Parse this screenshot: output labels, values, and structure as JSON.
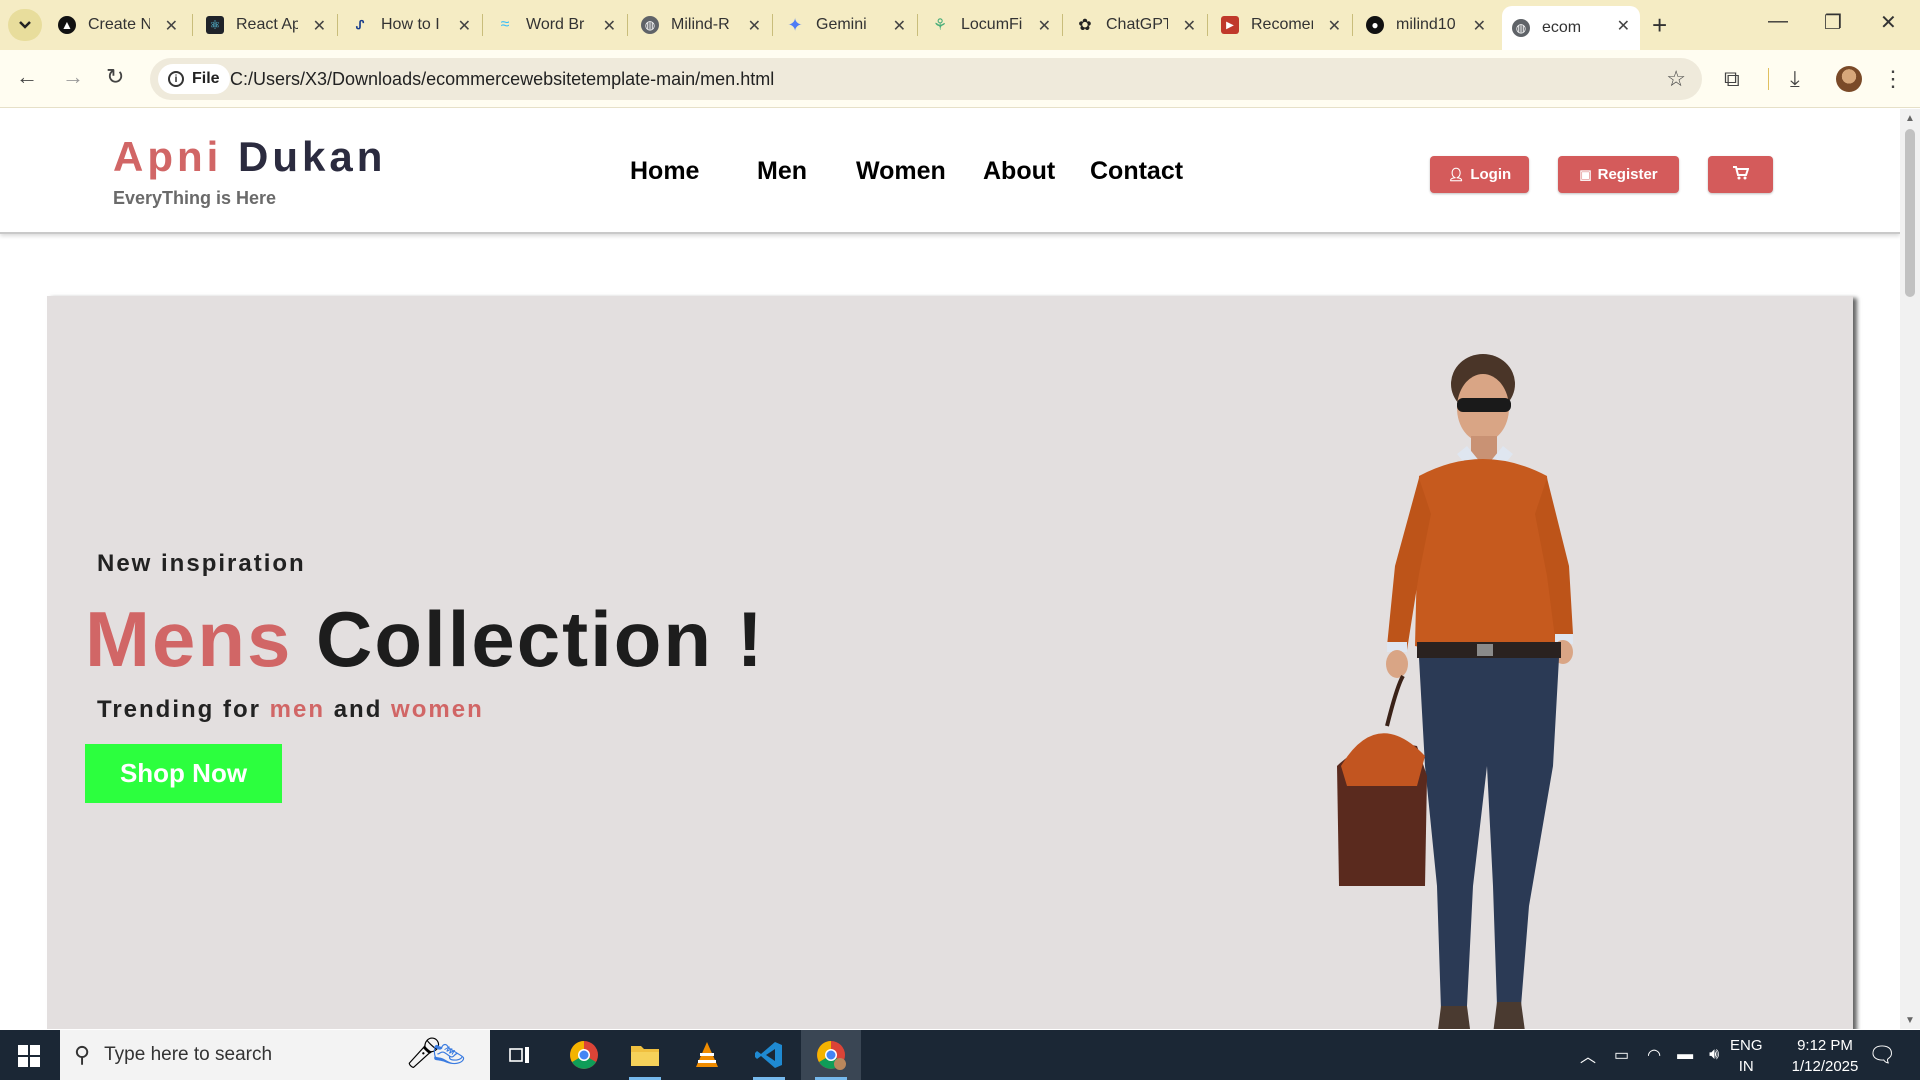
{
  "browser": {
    "tabs": [
      {
        "title": "Create N",
        "icon": "circle-dark-icon"
      },
      {
        "title": "React Ap",
        "icon": "react-icon"
      },
      {
        "title": "How to I",
        "icon": "link-icon"
      },
      {
        "title": "Word Br",
        "icon": "tailwind-icon"
      },
      {
        "title": "Milind-R",
        "icon": "globe-icon"
      },
      {
        "title": "Gemini",
        "icon": "gemini-icon"
      },
      {
        "title": "LocumFi",
        "icon": "locum-icon"
      },
      {
        "title": "ChatGPT",
        "icon": "chatgpt-icon"
      },
      {
        "title": "Recomer",
        "icon": "recommender-icon"
      },
      {
        "title": "milind10",
        "icon": "github-icon"
      },
      {
        "title": "ecom",
        "icon": "globe-icon",
        "active": true
      }
    ],
    "address": {
      "chip_label": "File",
      "url": "C:/Users/X3/Downloads/ecommercewebsitetemplate-main/men.html"
    }
  },
  "site": {
    "logo_part1": "Apni",
    "logo_part2": "Dukan",
    "tagline": "EveryThing is Here",
    "nav": [
      "Home",
      "Men",
      "Women",
      "About",
      "Contact"
    ],
    "buttons": {
      "login": "Login",
      "register": "Register"
    },
    "hero": {
      "subtitle": "New inspiration",
      "title_accent": "Mens",
      "title_rest": " Collection !",
      "trend_prefix": "Trending for ",
      "trend_men": "men",
      "trend_and": " and ",
      "trend_women": "women",
      "cta": "Shop Now"
    },
    "colors": {
      "accent": "#d16666",
      "button": "#d45b5b",
      "cta": "#2cff3e",
      "hero_bg": "#e3dfdf"
    }
  },
  "taskbar": {
    "search_placeholder": "Type here to search",
    "lang_top": "ENG",
    "lang_bottom": "IN",
    "time": "9:12 PM",
    "date": "1/12/2025"
  }
}
